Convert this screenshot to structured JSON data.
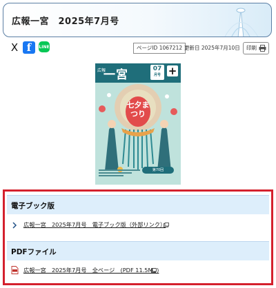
{
  "header": {
    "title": "広報一宮　2025年7月号"
  },
  "share": {
    "x_label": "X",
    "facebook_label": "f",
    "line_label": "LINE"
  },
  "meta": {
    "page_id": "ページID 1067212",
    "updated": "更新日 2025年7月10日",
    "print_label": "印刷"
  },
  "cover": {
    "small_label": "広報",
    "masthead": "一宮",
    "issue_number": "07",
    "issue_sub": "月号",
    "plus": "+",
    "feature": "七夕まつり",
    "badge": "第70回"
  },
  "sections": [
    {
      "title": "電子ブック版",
      "link": "広報一宮　2025年7月号　電子ブック版（外部リンク）"
    },
    {
      "title": "PDFファイル",
      "link": "広報一宮　2025年7月号　全ページ　(PDF 11.5MB)"
    }
  ],
  "colors": {
    "accent_red": "#d4202d",
    "section_bg": "#ddeefb",
    "cover_teal": "#1f6e7a",
    "facebook": "#1877f2",
    "line": "#06c755"
  }
}
